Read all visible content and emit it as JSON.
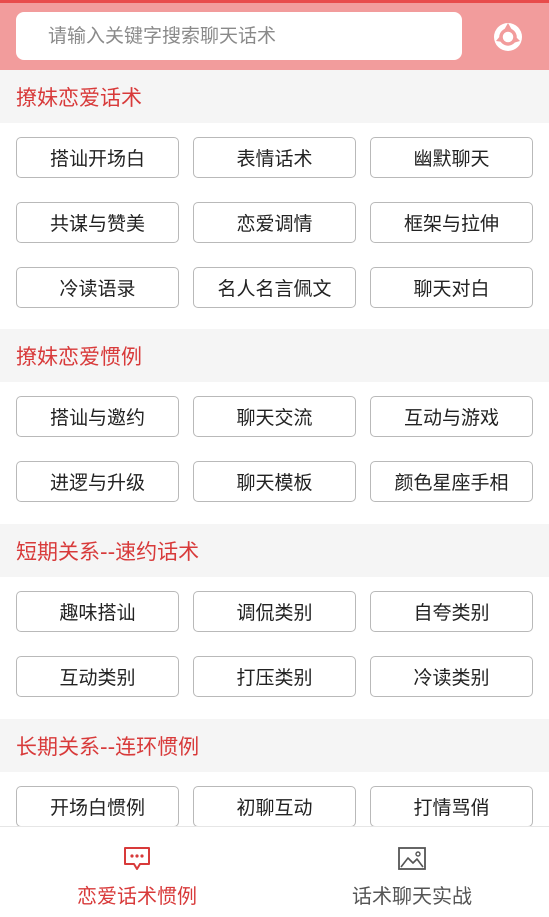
{
  "search": {
    "placeholder": "请输入关键字搜索聊天话术"
  },
  "sections": [
    {
      "title": "撩妹恋爱话术",
      "items": [
        "搭讪开场白",
        "表情话术",
        "幽默聊天",
        "共谋与赞美",
        "恋爱调情",
        "框架与拉伸",
        "冷读语录",
        "名人名言佩文",
        "聊天对白"
      ]
    },
    {
      "title": "撩妹恋爱惯例",
      "items": [
        "搭讪与邀约",
        "聊天交流",
        "互动与游戏",
        "进逻与升级",
        "聊天模板",
        "颜色星座手相"
      ]
    },
    {
      "title": "短期关系--速约话术",
      "items": [
        "趣味搭讪",
        "调侃类别",
        "自夸类别",
        "互动类别",
        "打压类别",
        "冷读类别"
      ]
    },
    {
      "title": "长期关系--连环惯例",
      "items": [
        "开场白惯例",
        "初聊互动",
        "打情骂俏"
      ]
    }
  ],
  "tabs": [
    {
      "label": "恋爱话术惯例",
      "icon": "chat-bubble-icon",
      "active": true
    },
    {
      "label": "话术聊天实战",
      "icon": "image-icon",
      "active": false
    }
  ],
  "colors": {
    "accent": "#d83a3a",
    "header_bg": "#f29c9c",
    "section_bg": "#f5f5f5"
  }
}
